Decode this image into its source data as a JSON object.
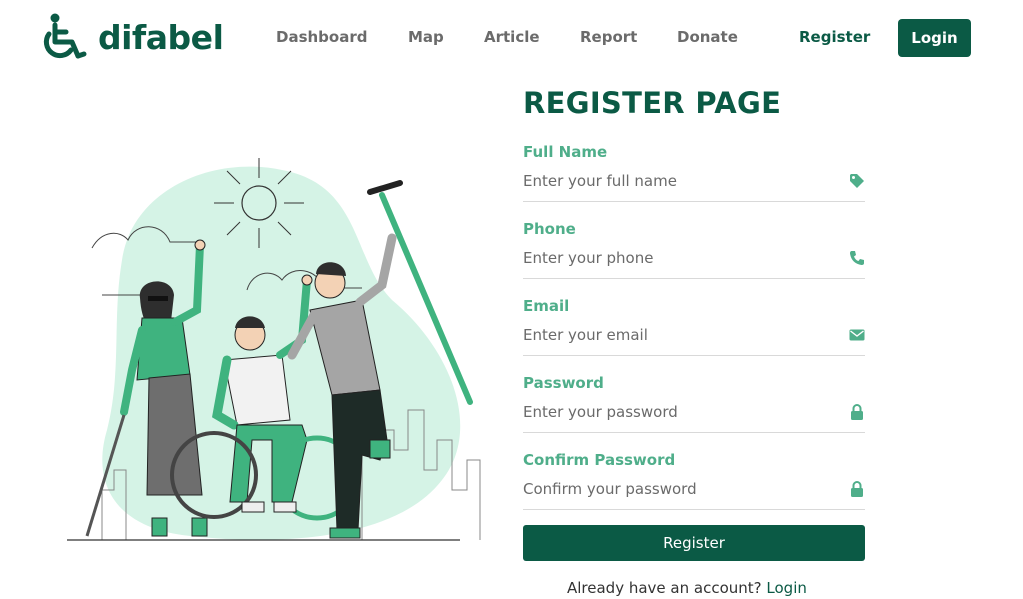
{
  "brand": {
    "name": "difabel",
    "logo_icon": "wheelchair-icon",
    "color": "#0b5a45",
    "accent": "#4fae8a"
  },
  "nav": {
    "links": [
      "Dashboard",
      "Map",
      "Article",
      "Report",
      "Donate"
    ],
    "register_label": "Register",
    "login_label": "Login"
  },
  "form": {
    "title": "REGISTER PAGE",
    "fields": [
      {
        "label": "Full Name",
        "placeholder": "Enter your full name",
        "icon": "tag-icon",
        "type": "text"
      },
      {
        "label": "Phone",
        "placeholder": "Enter your phone",
        "icon": "phone-icon",
        "type": "tel"
      },
      {
        "label": "Email",
        "placeholder": "Enter your email",
        "icon": "envelope-icon",
        "type": "email"
      },
      {
        "label": "Password",
        "placeholder": "Enter your password",
        "icon": "lock-icon",
        "type": "password"
      },
      {
        "label": "Confirm Password",
        "placeholder": "Confirm your password",
        "icon": "lock-icon",
        "type": "password"
      }
    ],
    "submit_label": "Register",
    "footer_prefix": "Already have an account?",
    "footer_link": "Login"
  }
}
